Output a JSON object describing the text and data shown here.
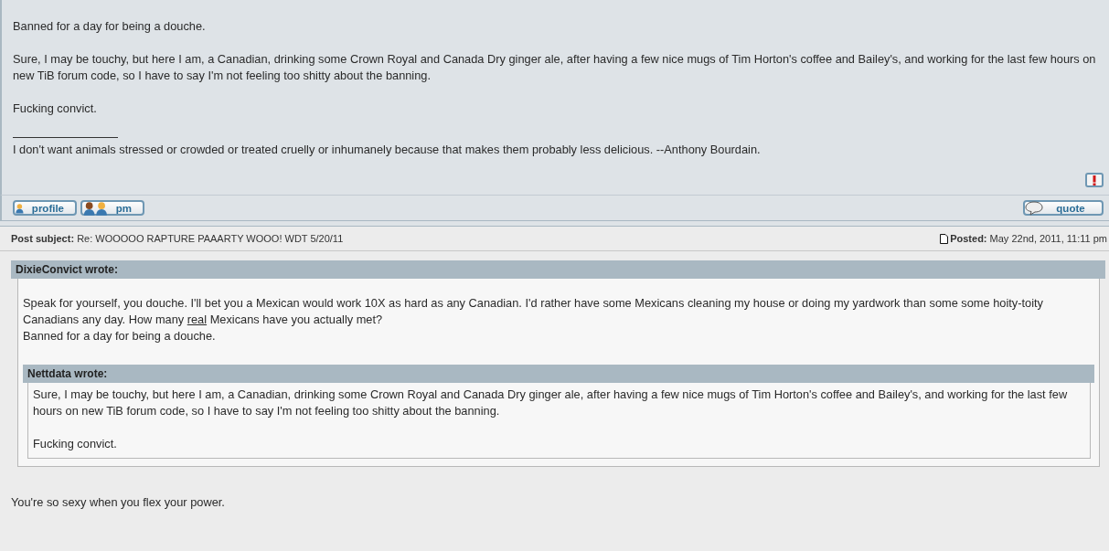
{
  "previous_post": {
    "paragraphs": [
      "Banned for a day for being a douche.",
      "Sure, I may be touchy, but here I am, a Canadian, drinking some Crown Royal and Canada Dry ginger ale, after having a few nice mugs of Tim Horton's coffee and Bailey's, and working for the last few hours on new TiB forum code, so I have to say I'm not feeling too shitty about the banning.",
      "Fucking convict."
    ],
    "signature": "I don't want animals stressed or crowded or treated cruelly or inhumanely because that makes them probably less delicious. --Anthony Bourdain.",
    "buttons": [
      {
        "kind": "profile",
        "label": "profile"
      },
      {
        "kind": "pm",
        "label": "pm"
      },
      {
        "kind": "quote",
        "label": "quote"
      }
    ]
  },
  "post": {
    "subject_label": "Post subject:",
    "subject": "Re: WOOOOO RAPTURE PAAARTY WOOO! WDT 5/20/11",
    "posted_label": "Posted:",
    "posted": "May 22nd, 2011, 11:11 pm",
    "quote": {
      "author": "DixieConvict wrote:",
      "lines": [
        [
          {
            "text": "Speak for yourself, you douche. I'll bet you a Mexican would work 10X as hard as any Canadian. I'd rather have some Mexicans cleaning my house or doing my yardwork than some some hoity-toity Canadians any day. How many ",
            "underline": false
          },
          {
            "text": "real",
            "underline": true
          },
          {
            "text": " Mexicans have you actually met?",
            "underline": false
          }
        ],
        [
          {
            "text": "Banned for a day for being a douche.",
            "underline": false
          }
        ]
      ],
      "quote": {
        "author": "Nettdata wrote:",
        "paragraphs": [
          "Sure, I may be touchy, but here I am, a Canadian, drinking some Crown Royal and Canada Dry ginger ale, after having a few nice mugs of Tim Horton's coffee and Bailey's, and working for the last few hours on new TiB forum code, so I have to say I'm not feeling too shitty about the banning.",
          "Fucking convict."
        ]
      }
    },
    "text": "You're so sexy when you flex your power."
  }
}
